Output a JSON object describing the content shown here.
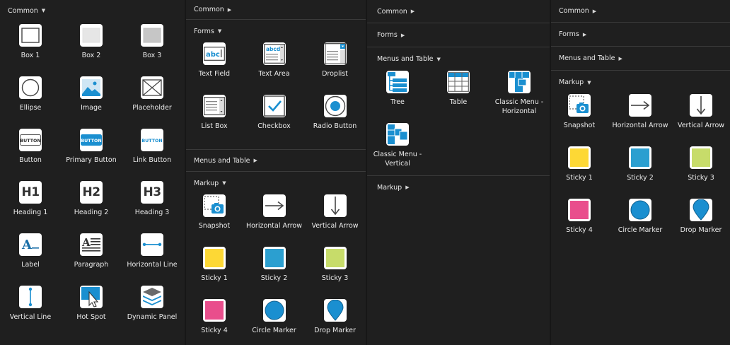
{
  "panel1": {
    "header": "Common",
    "arrow": "▼",
    "items": [
      {
        "label": "Box 1",
        "icon": "box1-icon"
      },
      {
        "label": "Box 2",
        "icon": "box2-icon"
      },
      {
        "label": "Box 3",
        "icon": "box3-icon"
      },
      {
        "label": "Ellipse",
        "icon": "ellipse-icon"
      },
      {
        "label": "Image",
        "icon": "image-icon"
      },
      {
        "label": "Placeholder",
        "icon": "placeholder-icon"
      },
      {
        "label": "Button",
        "icon": "button-icon",
        "text": "BUTTON"
      },
      {
        "label": "Primary Button",
        "icon": "primary-button-icon",
        "text": "BUTTON"
      },
      {
        "label": "Link Button",
        "icon": "link-button-icon",
        "text": "BUTTON"
      },
      {
        "label": "Heading 1",
        "icon": "heading1-icon",
        "text": "H1"
      },
      {
        "label": "Heading 2",
        "icon": "heading2-icon",
        "text": "H2"
      },
      {
        "label": "Heading 3",
        "icon": "heading3-icon",
        "text": "H3"
      },
      {
        "label": "Label",
        "icon": "label-icon",
        "text": "A"
      },
      {
        "label": "Paragraph",
        "icon": "paragraph-icon",
        "text": "A"
      },
      {
        "label": "Horizontal Line",
        "icon": "horizontal-line-icon"
      },
      {
        "label": "Vertical Line",
        "icon": "vertical-line-icon"
      },
      {
        "label": "Hot Spot",
        "icon": "hot-spot-icon"
      },
      {
        "label": "Dynamic Panel",
        "icon": "dynamic-panel-icon"
      }
    ]
  },
  "panel2": {
    "common": {
      "header": "Common",
      "arrow": "▶"
    },
    "forms": {
      "header": "Forms",
      "arrow": "▼",
      "items": [
        {
          "label": "Text Field",
          "icon": "text-field-icon",
          "text": "abc"
        },
        {
          "label": "Text Area",
          "icon": "text-area-icon",
          "text": "abcd"
        },
        {
          "label": "Droplist",
          "icon": "droplist-icon"
        },
        {
          "label": "List Box",
          "icon": "list-box-icon"
        },
        {
          "label": "Checkbox",
          "icon": "checkbox-icon"
        },
        {
          "label": "Radio Button",
          "icon": "radio-button-icon"
        }
      ]
    },
    "menus": {
      "header": "Menus and Table",
      "arrow": "▶"
    },
    "markup": {
      "header": "Markup",
      "arrow": "▼",
      "items": [
        {
          "label": "Snapshot",
          "icon": "snapshot-icon"
        },
        {
          "label": "Horizontal Arrow",
          "icon": "horizontal-arrow-icon"
        },
        {
          "label": "Vertical Arrow",
          "icon": "vertical-arrow-icon"
        },
        {
          "label": "Sticky 1",
          "icon": "sticky1-icon"
        },
        {
          "label": "Sticky 2",
          "icon": "sticky2-icon"
        },
        {
          "label": "Sticky 3",
          "icon": "sticky3-icon"
        },
        {
          "label": "Sticky 4",
          "icon": "sticky4-icon"
        },
        {
          "label": "Circle Marker",
          "icon": "circle-marker-icon"
        },
        {
          "label": "Drop Marker",
          "icon": "drop-marker-icon"
        }
      ]
    }
  },
  "panel3": {
    "common": {
      "header": "Common",
      "arrow": "▶"
    },
    "forms": {
      "header": "Forms",
      "arrow": "▶"
    },
    "menus": {
      "header": "Menus and Table",
      "arrow": "▼",
      "items": [
        {
          "label": "Tree",
          "icon": "tree-icon"
        },
        {
          "label": "Table",
          "icon": "table-icon"
        },
        {
          "label": "Classic Menu -\nHorizontal",
          "icon": "classic-menu-horizontal-icon"
        },
        {
          "label": "Classic Menu -\nVertical",
          "icon": "classic-menu-vertical-icon"
        }
      ]
    },
    "markup": {
      "header": "Markup",
      "arrow": "▶"
    }
  },
  "panel4": {
    "common": {
      "header": "Common",
      "arrow": "▶"
    },
    "forms": {
      "header": "Forms",
      "arrow": "▶"
    },
    "menus": {
      "header": "Menus and Table",
      "arrow": "▶"
    },
    "markup": {
      "header": "Markup",
      "arrow": "▼",
      "items": [
        {
          "label": "Snapshot",
          "icon": "snapshot-icon"
        },
        {
          "label": "Horizontal Arrow",
          "icon": "horizontal-arrow-icon"
        },
        {
          "label": "Vertical Arrow",
          "icon": "vertical-arrow-icon"
        },
        {
          "label": "Sticky 1",
          "icon": "sticky1-icon"
        },
        {
          "label": "Sticky 2",
          "icon": "sticky2-icon"
        },
        {
          "label": "Sticky 3",
          "icon": "sticky3-icon"
        },
        {
          "label": "Sticky 4",
          "icon": "sticky4-icon"
        },
        {
          "label": "Circle Marker",
          "icon": "circle-marker-icon"
        },
        {
          "label": "Drop Marker",
          "icon": "drop-marker-icon"
        }
      ]
    }
  },
  "colors": {
    "accent": "#1a8fd0",
    "sticky1": "#fdd835",
    "sticky2": "#2b9fd0",
    "sticky3": "#c7dc6a",
    "sticky4": "#e94e8c"
  }
}
